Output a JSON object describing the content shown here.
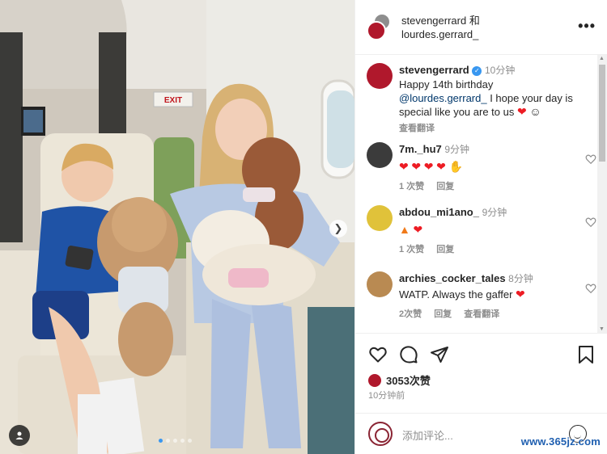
{
  "post": {
    "author_line1": "stevengerrard 和",
    "author_line2": "lourdes.gerrard_",
    "more_icon": "more-horizontal-icon"
  },
  "caption": {
    "username": "stevengerrard",
    "time": "10分钟",
    "text_1": "Happy 14th birthday",
    "mention": "@lourdes.gerrard_",
    "text_2": " I hope your day is special like you are to us",
    "translate": "查看翻译"
  },
  "comments": [
    {
      "username": "7m._hu7",
      "time": "9分钟",
      "text": "",
      "likes": "1 次赞",
      "reply": "回复"
    },
    {
      "username": "abdou_mi1ano_",
      "time": "9分钟",
      "text": "",
      "likes": "1 次赞",
      "reply": "回复"
    },
    {
      "username": "archies_cocker_tales",
      "time": "8分钟",
      "text": "WATP. Always the gaffer",
      "likes": "2次赞",
      "reply": "回复",
      "translate": "查看翻译"
    }
  ],
  "actions": {
    "likes": "3053次赞",
    "post_time": "10分钟前",
    "comment_placeholder": "添加评论..."
  },
  "photo": {
    "exit_sign": "EXIT"
  },
  "watermark": "www.365jz.com",
  "colors": {
    "accent": "#3897f0",
    "heart": "#ed1c24",
    "brand_red": "#b0182c"
  }
}
